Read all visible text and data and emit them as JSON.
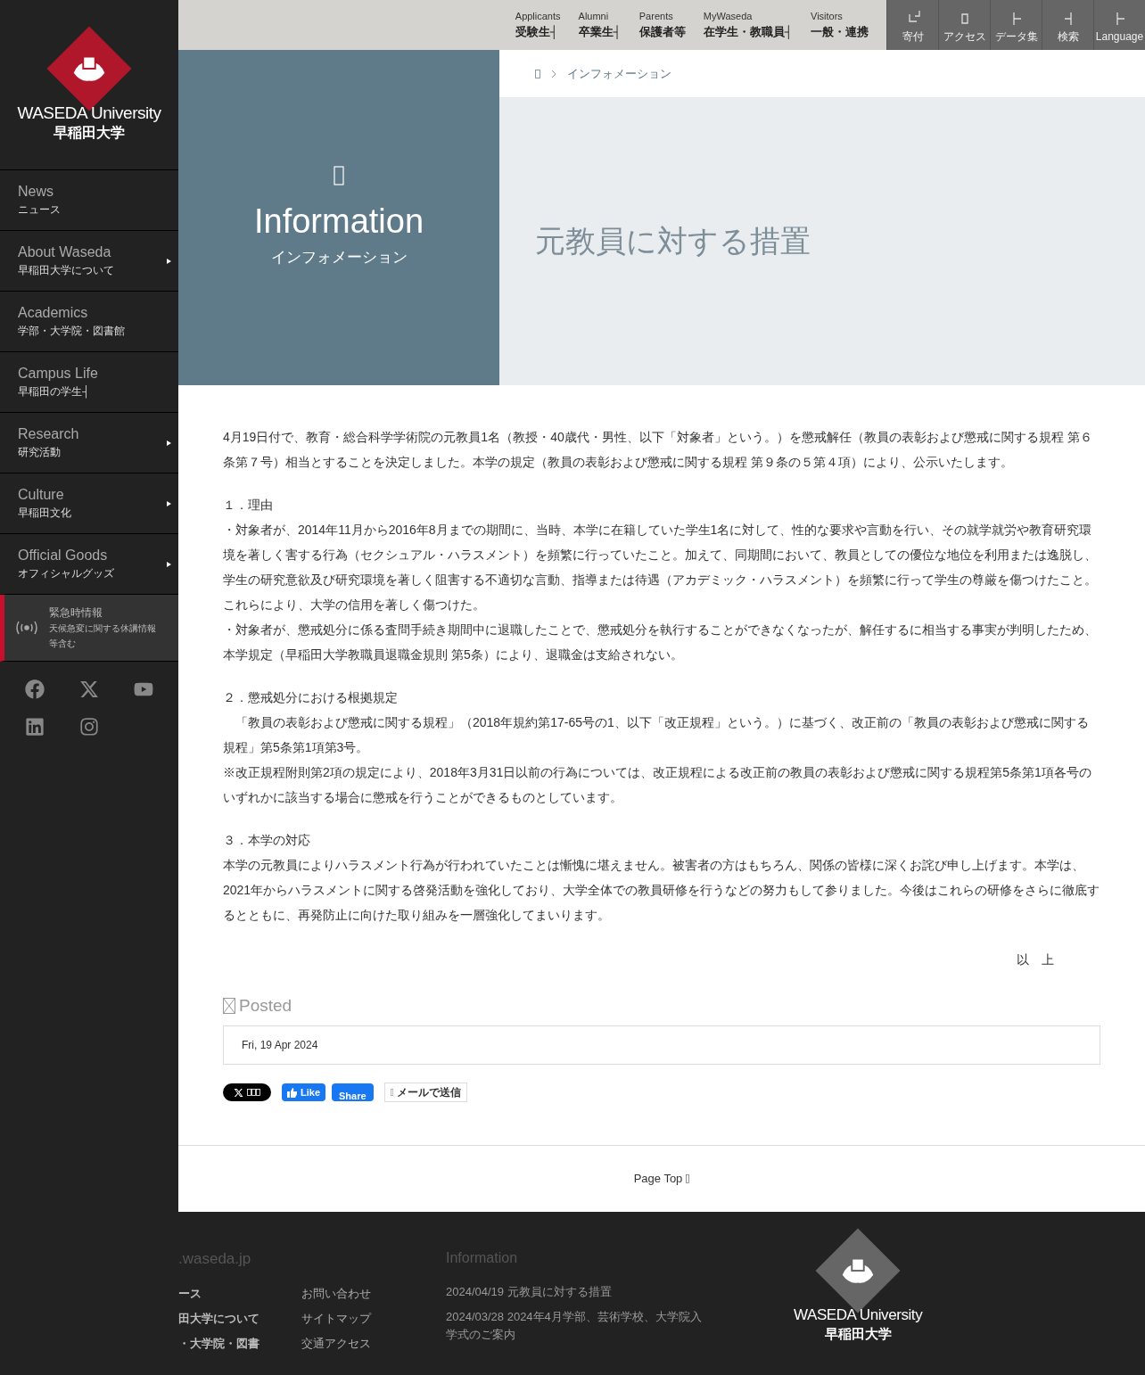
{
  "logo": {
    "name_en": "WASEDA University",
    "name_ja": "早稲田大学"
  },
  "sidebar": {
    "items": [
      {
        "en": "News",
        "ja": "ニュース",
        "expandable": false
      },
      {
        "en": "About Waseda",
        "ja": "早稲田大学について",
        "expandable": true
      },
      {
        "en": "Academics",
        "ja": "学部・大学院・図書館",
        "expandable": false
      },
      {
        "en": "Campus Life",
        "ja": "早稲田の学生┤",
        "expandable": false
      },
      {
        "en": "Research",
        "ja": "研究活動",
        "expandable": true
      },
      {
        "en": "Culture",
        "ja": "早稲田文化",
        "expandable": true
      },
      {
        "en": "Official Goods",
        "ja": "オフィシャルグッズ",
        "expandable": true
      }
    ],
    "emergency": {
      "title": "緊急時情報",
      "text": "天候急変に関する休講情報等含む"
    }
  },
  "top_nav": {
    "audiences": [
      {
        "en": "Applicants",
        "ja": "受験生┤"
      },
      {
        "en": "Alumni",
        "ja": "卒業生┤"
      },
      {
        "en": "Parents",
        "ja": "保護者等"
      },
      {
        "en": "MyWaseda",
        "ja": "在学生・教職員┤"
      },
      {
        "en": "Visitors",
        "ja": "一般・連携"
      }
    ],
    "tools": [
      {
        "label": "寄付",
        "kind": "corner"
      },
      {
        "label": "アクセス",
        "kind": "box"
      },
      {
        "label": "データ集",
        "kind": "tee"
      },
      {
        "label": "検索",
        "kind": "rtee"
      },
      {
        "label": "Language",
        "kind": "tee"
      }
    ]
  },
  "breadcrumb": [
    "インフォメーション"
  ],
  "hero": {
    "category_en": "Information",
    "category_ja": "インフォメーション",
    "title": "元教員に対する措置"
  },
  "article": {
    "intro": "4月19日付で、教育・総合科学学術院の元教員1名（教授・40歳代・男性、以下「対象者」という。）を懲戒解任（教員の表彰および懲戒に関する規程 第６条第７号）相当とすることを決定しました。本学の規定（教員の表彰および懲戒に関する規程 第９条の５第４項）により、公示いたします。",
    "sections": [
      {
        "heading": "１．理由",
        "paragraphs": [
          "・対象者が、2014年11月から2016年8月までの期間に、当時、本学に在籍していた学生1名に対して、性的な要求や言動を行い、その就学就労や教育研究環境を著しく害する行為（セクシュアル・ハラスメント）を頻繁に行っていたこと。加えて、同期間において、教員としての優位な地位を利用または逸脱し、学生の研究意欲及び研究環境を著しく阻害する不適切な言動、指導または待遇（アカデミック・ハラスメント）を頻繁に行って学生の尊厳を傷つけたこと。これらにより、大学の信用を著しく傷つけた。",
          "・対象者が、懲戒処分に係る査問手続き期間中に退職したことで、懲戒処分を執行することができなくなったが、解任するに相当する事実が判明したため、本学規定（早稲田大学教職員退職金規則 第5条）により、退職金は支給されない。"
        ]
      },
      {
        "heading": "２．懲戒処分における根拠規定",
        "paragraphs": [
          "　「教員の表彰および懲戒に関する規程」（2018年規約第17-65号の1、以下「改正規程」という。）に基づく、改正前の「教員の表彰および懲戒に関する規程」第5条第1項第3号。",
          "※改正規程附則第2項の規定により、2018年3月31日以前の行為については、改正規程による改正前の教員の表彰および懲戒に関する規程第5条第1項各号のいずれかに該当する場合に懲戒を行うことができるものとしています。"
        ]
      },
      {
        "heading": "３．本学の対応",
        "paragraphs": [
          "本学の元教員によりハラスメント行為が行われていたことは慚愧に堪えません。被害者の方はもちろん、関係の皆様に深くお詫び申し上げます。本学は、2021年からハラスメントに関する啓発活動を強化しており、大学全体での教員研修を行うなどの努力もして参りました。今後はこれらの研修をさらに徹底するとともに、再発防止に向けた取り組みを一層強化してまいります。"
        ]
      }
    ],
    "closing": "以　上"
  },
  "posted": {
    "label": "Posted",
    "date": "Fri, 19 Apr 2024"
  },
  "share": {
    "like": "Like",
    "share": "Share",
    "mail": "メールで送信"
  },
  "page_top": "Page Top",
  "footer_logo": {
    "name_en": "WASEDA University",
    "name_ja": "早稲田大学"
  },
  "footer": {
    "site": ".waseda.jp",
    "col1": [
      "ース",
      "田大学について",
      "・大学院・図書"
    ],
    "col2": [
      "お問い合わせ",
      "サイトマップ",
      "交通アクセス"
    ],
    "info_title": "Information",
    "info": [
      "2024/04/19 元教員に対する措置",
      "2024/03/28 2024年4月学部、芸術学校、大学院入学式のご案内"
    ]
  }
}
